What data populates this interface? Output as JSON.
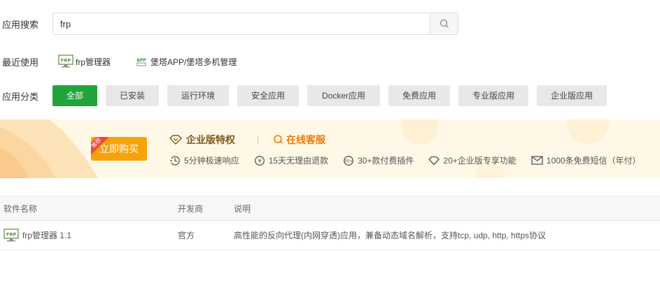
{
  "search": {
    "label": "应用搜索",
    "value": "frp"
  },
  "recent": {
    "label": "最近使用",
    "items": [
      {
        "icon": "frp-icon",
        "name": "frp管理器"
      },
      {
        "icon": "app-icon",
        "name": "堡塔APP/堡塔多机管理"
      }
    ]
  },
  "categories": {
    "label": "应用分类",
    "items": [
      "全部",
      "已安装",
      "运行环境",
      "安全应用",
      "Docker应用",
      "免费应用",
      "专业版应用",
      "企业版应用"
    ],
    "active": "全部"
  },
  "banner": {
    "ribbon": "推荐",
    "buy_label": "立即购买",
    "privilege": "企业版特权",
    "service": "在线客服",
    "features": [
      "5分钟极速响应",
      "15天无理由退款",
      "30+款付费插件",
      "20+企业版专享功能",
      "1000条免费短信（年付）"
    ]
  },
  "table": {
    "headers": [
      "软件名称",
      "开发商",
      "说明"
    ],
    "rows": [
      {
        "name": "frp管理器 1.1",
        "vendor": "官方",
        "desc": "高性能的反向代理(内网穿透)应用，兼备动态域名解析，支持tcp, udp, http, https协议"
      }
    ]
  },
  "colors": {
    "accent": "#20a53a",
    "buy": "#f8a20a",
    "service": "#e87e0a"
  }
}
